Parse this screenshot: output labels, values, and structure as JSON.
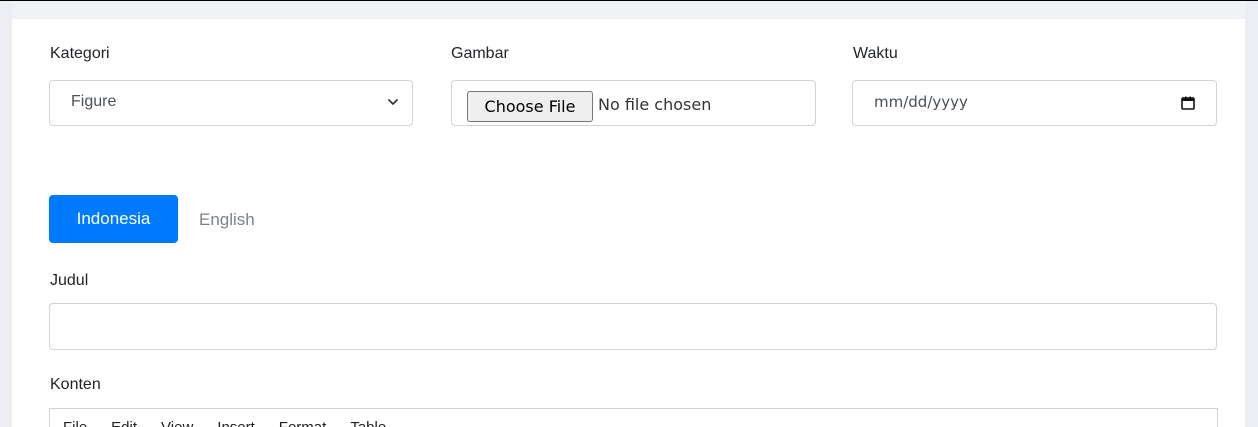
{
  "colors": {
    "accent": "#007bff",
    "border": "#ced4da",
    "gutter": "#edeef3"
  },
  "form": {
    "kategori": {
      "label": "Kategori",
      "selected": "Figure"
    },
    "gambar": {
      "label": "Gambar",
      "button": "Choose File",
      "status": "No file chosen"
    },
    "waktu": {
      "label": "Waktu",
      "placeholder": "mm/dd/yyyy"
    },
    "tabs": [
      {
        "label": "Indonesia",
        "active": true
      },
      {
        "label": "English",
        "active": false
      }
    ],
    "judul": {
      "label": "Judul",
      "value": ""
    },
    "konten": {
      "label": "Konten",
      "toolbar": [
        "File",
        "Edit",
        "View",
        "Insert",
        "Format",
        "Table"
      ]
    }
  },
  "icons": {
    "select_arrow": "chevron-down-icon",
    "date_picker": "calendar-icon"
  }
}
